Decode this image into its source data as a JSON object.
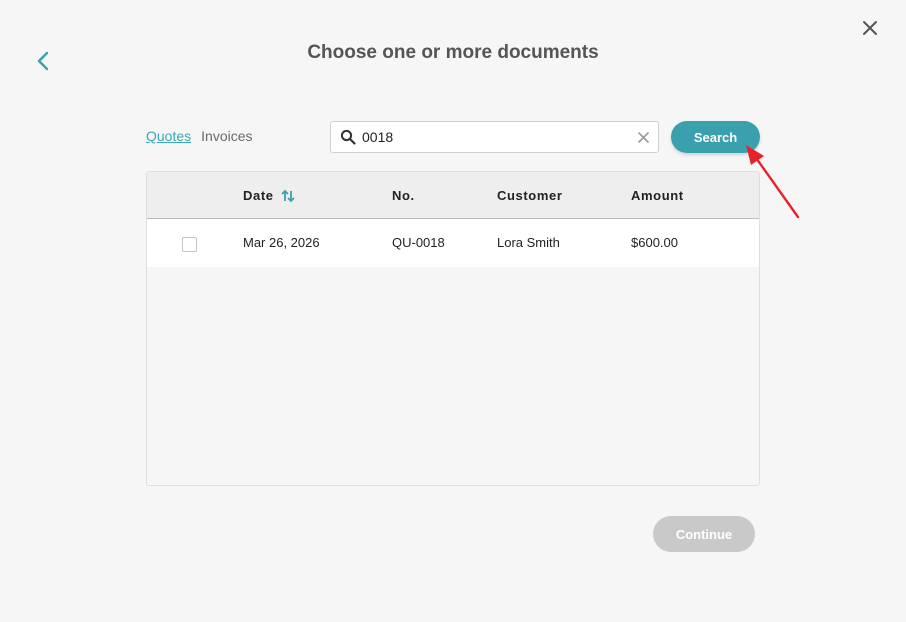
{
  "dialog": {
    "title": "Choose one or more documents"
  },
  "tabs": [
    {
      "label": "Quotes",
      "active": true
    },
    {
      "label": "Invoices",
      "active": false
    }
  ],
  "search": {
    "value": "0018",
    "placeholder": "",
    "button_label": "Search"
  },
  "table": {
    "columns": {
      "date": "Date",
      "number": "No.",
      "customer": "Customer",
      "amount": "Amount"
    },
    "rows": [
      {
        "date": "Mar 26, 2026",
        "number": "QU-0018",
        "customer": "Lora Smith",
        "amount": "$600.00",
        "checked": false
      }
    ]
  },
  "footer": {
    "continue_label": "Continue"
  },
  "colors": {
    "accent": "#3aa0ad",
    "link": "#3ba8b6",
    "disabled": "#c9c9c9",
    "annotation": "#e8222b"
  },
  "icons": [
    "back-arrow-icon",
    "close-icon",
    "search-icon",
    "clear-icon",
    "sort-icon"
  ]
}
